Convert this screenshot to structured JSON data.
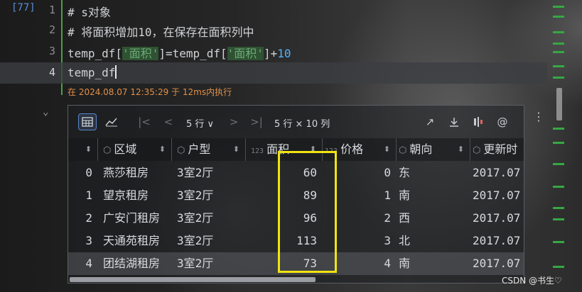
{
  "editor": {
    "exec_count": "[77]",
    "lines": [
      {
        "num": "1",
        "text": "# s对象"
      },
      {
        "num": "2",
        "text": "# 将面积增加10，在保存在面积列中"
      },
      {
        "num": "3",
        "p1": "temp_df[",
        "s1": "'面积'",
        "p2": "]=temp_df[",
        "s2": "'面积'",
        "p3": "]+",
        "n": "10"
      },
      {
        "num": "4",
        "text": "temp_df"
      }
    ],
    "exec_status": "在 2024.08.07 12:35:29 于 12ms内执行"
  },
  "toolbar": {
    "row_count": "5 行 ∨",
    "shape": "5 行 × 10 列"
  },
  "table": {
    "columns": [
      "区域",
      "户型",
      "面积",
      "价格",
      "朝向",
      "更新时"
    ],
    "column_icons": [
      "cube-icon",
      "cube-icon",
      "number-icon",
      "number-icon",
      "cube-icon",
      "cube-icon"
    ],
    "number_icon_text": "123",
    "rows": [
      {
        "idx": "0",
        "area": "燕莎租房",
        "layout": "3室2厅",
        "size": "60",
        "price": "0",
        "dir": "东",
        "updated": "2017.07"
      },
      {
        "idx": "1",
        "area": "望京租房",
        "layout": "3室2厅",
        "size": "89",
        "price": "1",
        "dir": "南",
        "updated": "2017.07"
      },
      {
        "idx": "2",
        "area": "广安门租房",
        "layout": "3室2厅",
        "size": "96",
        "price": "2",
        "dir": "西",
        "updated": "2017.07"
      },
      {
        "idx": "3",
        "area": "天通苑租房",
        "layout": "3室2厅",
        "size": "113",
        "price": "3",
        "dir": "北",
        "updated": "2017.07"
      },
      {
        "idx": "4",
        "area": "团结湖租房",
        "layout": "3室2厅",
        "size": "73",
        "price": "4",
        "dir": "南",
        "updated": "2017.07"
      }
    ]
  },
  "watermark": "CSDN @书生♡",
  "colors": {
    "accent_green": "#35a845",
    "highlight_yellow": "#f1e40f",
    "status_orange": "#e0904a"
  }
}
